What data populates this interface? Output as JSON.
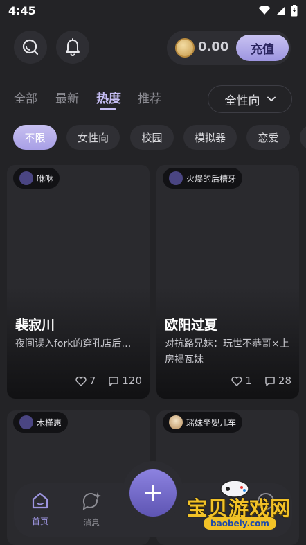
{
  "status_bar": {
    "time": "4:45"
  },
  "header": {
    "balance": "0.00",
    "recharge_label": "充值"
  },
  "tabs": [
    {
      "label": "全部"
    },
    {
      "label": "最新"
    },
    {
      "label": "热度"
    },
    {
      "label": "推荐"
    }
  ],
  "gender_filter": {
    "value": "全性向"
  },
  "chips": [
    {
      "label": "不限"
    },
    {
      "label": "女性向"
    },
    {
      "label": "校园"
    },
    {
      "label": "模拟器"
    },
    {
      "label": "恋爱"
    }
  ],
  "cards": [
    {
      "author": "咻咻",
      "title": "裴寂川",
      "desc": "夜间误入fork的穿孔店后…",
      "likes": "7",
      "comments": "120"
    },
    {
      "author": "火爆的后槽牙",
      "title": "欧阳过夏",
      "desc": "对抗路兄妹：玩世不恭哥×上房揭瓦妹",
      "likes": "1",
      "comments": "28"
    },
    {
      "author": "木槿惠"
    },
    {
      "author": "瑶妹坐婴儿车"
    }
  ],
  "bottom_nav": {
    "home_label": "首页",
    "messages_label": "消息",
    "mine_label": "我的"
  },
  "watermark": {
    "text": "宝贝游戏网",
    "url": "baobeiy.com"
  },
  "colors": {
    "accent": "#9d95e0",
    "background": "#232326",
    "card": "#2a2a2e"
  }
}
